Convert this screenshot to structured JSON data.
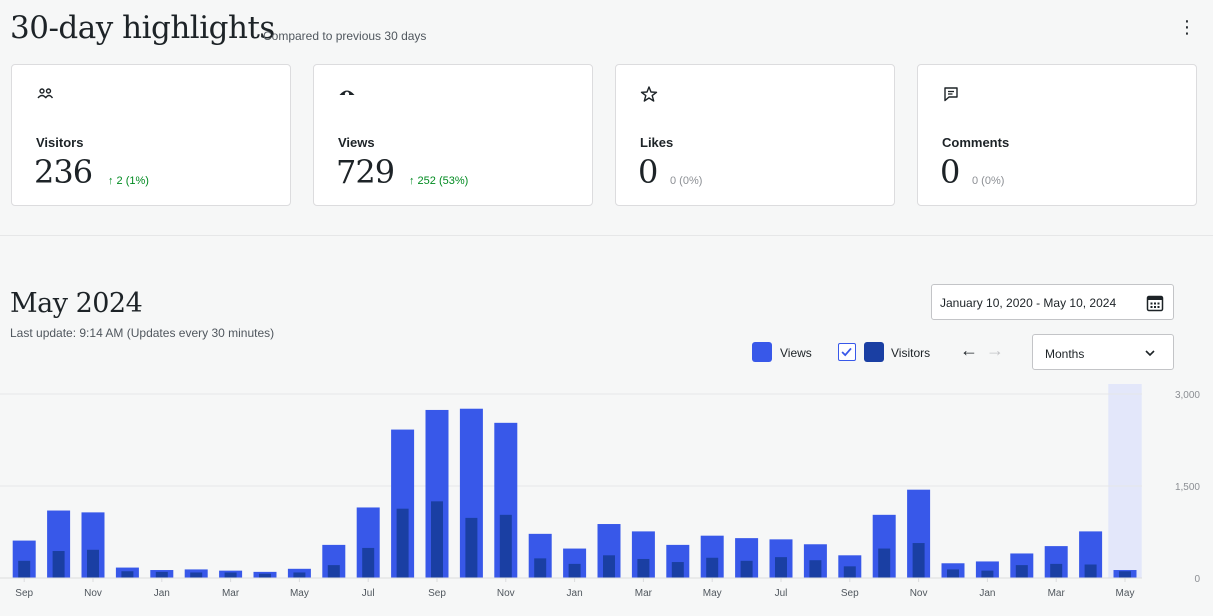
{
  "highlights": {
    "title": "30-day highlights",
    "subtitle": "Compared to previous 30 days",
    "menu_glyph": "⋮",
    "cards": [
      {
        "icon": "people-icon",
        "label": "Visitors",
        "value": "236",
        "delta": "↑ 2 (1%)",
        "trend": "up"
      },
      {
        "icon": "eye-icon",
        "label": "Views",
        "value": "729",
        "delta": "↑ 252 (53%)",
        "trend": "up"
      },
      {
        "icon": "star-icon",
        "label": "Likes",
        "value": "0",
        "delta": "0 (0%)",
        "trend": "neutral"
      },
      {
        "icon": "comment-icon",
        "label": "Comments",
        "value": "0",
        "delta": "0 (0%)",
        "trend": "neutral"
      }
    ]
  },
  "chart_section": {
    "title": "May 2024",
    "last_update": "Last update: 9:14 AM (Updates every 30 minutes)",
    "date_range": "January 10, 2020 - May 10, 2024",
    "legend": {
      "views": "Views",
      "visitors": "Visitors",
      "visitors_checked": true
    },
    "nav": {
      "prev": "←",
      "next": "→"
    },
    "period": "Months"
  },
  "colors": {
    "views": "#3858e9",
    "visitors": "#1a3fa3",
    "highlight": "#e3e7fa",
    "up": "#008a20"
  },
  "chart_data": {
    "type": "bar",
    "ylim": [
      0,
      3000
    ],
    "yticks": [
      "3,000",
      "1,500",
      "0"
    ],
    "ytick_values": [
      3000,
      1500,
      0
    ],
    "xtick_labels": [
      "Sep",
      "Nov",
      "Jan",
      "Mar",
      "May",
      "Jul",
      "Sep",
      "Nov",
      "Jan",
      "Mar",
      "May",
      "Jul",
      "Sep",
      "Nov",
      "Jan",
      "Mar",
      "May"
    ],
    "categories": [
      "Sep 2021",
      "Oct 2021",
      "Nov 2021",
      "Dec 2021",
      "Jan 2022",
      "Feb 2022",
      "Mar 2022",
      "Apr 2022",
      "May 2022",
      "Jun 2022",
      "Jul 2022",
      "Aug 2022",
      "Sep 2022",
      "Oct 2022",
      "Nov 2022",
      "Dec 2022",
      "Jan 2023",
      "Feb 2023",
      "Mar 2023",
      "Apr 2023",
      "May 2023",
      "Jun 2023",
      "Jul 2023",
      "Aug 2023",
      "Sep 2023",
      "Oct 2023",
      "Nov 2023",
      "Dec 2023",
      "Jan 2024",
      "Feb 2024",
      "Mar 2024",
      "Apr 2024",
      "May 2024"
    ],
    "series": [
      {
        "name": "Views",
        "values": [
          610,
          1100,
          1070,
          170,
          130,
          140,
          120,
          100,
          150,
          540,
          1150,
          2420,
          2740,
          2760,
          2530,
          720,
          480,
          880,
          760,
          540,
          690,
          650,
          630,
          550,
          370,
          1030,
          1440,
          240,
          270,
          400,
          520,
          760,
          130
        ]
      },
      {
        "name": "Visitors",
        "values": [
          280,
          440,
          460,
          110,
          100,
          90,
          90,
          70,
          90,
          210,
          490,
          1130,
          1250,
          980,
          1030,
          320,
          230,
          370,
          310,
          260,
          330,
          280,
          340,
          290,
          190,
          480,
          570,
          140,
          120,
          210,
          230,
          220,
          110
        ]
      }
    ],
    "highlighted_index": 32,
    "grid": true
  }
}
